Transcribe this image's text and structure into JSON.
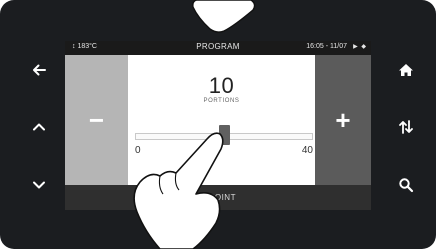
{
  "status": {
    "temperature": "↕ 183°C",
    "title": "PROGRAM",
    "datetime": "16:05 - 11/07",
    "icons": "▶ ◆"
  },
  "control": {
    "value": "10",
    "unit": "PORTIONS",
    "minus_label": "−",
    "plus_label": "+"
  },
  "slider": {
    "min_label": "0",
    "max_label": "40",
    "min": 0,
    "max": 40,
    "value": 20
  },
  "footer": {
    "label": "R POINT"
  },
  "nav": {
    "left": [
      "back-arrow-icon",
      "chevron-up-icon",
      "chevron-down-icon"
    ],
    "right": [
      "home-icon",
      "sort-arrows-icon",
      "search-icon"
    ]
  },
  "colors": {
    "bezel": "#1b1d20",
    "minus_panel": "#b5b5b5",
    "plus_panel": "#5b5b5b"
  }
}
